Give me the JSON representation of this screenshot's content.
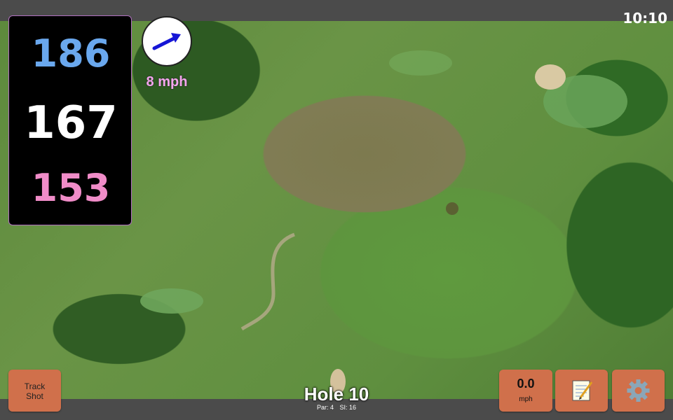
{
  "status": {
    "time": "10:10"
  },
  "distances": {
    "back": "186",
    "middle": "167",
    "front": "153"
  },
  "wind": {
    "speed_label": "8 mph",
    "icon": "wind-direction-arrow-icon",
    "arrow_color": "#1616d6"
  },
  "buttons": {
    "track_shot_line1": "Track",
    "track_shot_line2": "Shot",
    "speed_value": "0.0",
    "speed_unit": "mph",
    "notes_icon": "notepad-icon",
    "settings_icon": "gear-icon"
  },
  "hole": {
    "title": "Hole 10",
    "par": "Par: 4",
    "stroke_index": "SI: 16"
  },
  "colors": {
    "back": "#6aa8ee",
    "middle": "#ffffff",
    "front": "#f08cc8",
    "button": "#d0704b",
    "bar": "#4b4b4b"
  }
}
